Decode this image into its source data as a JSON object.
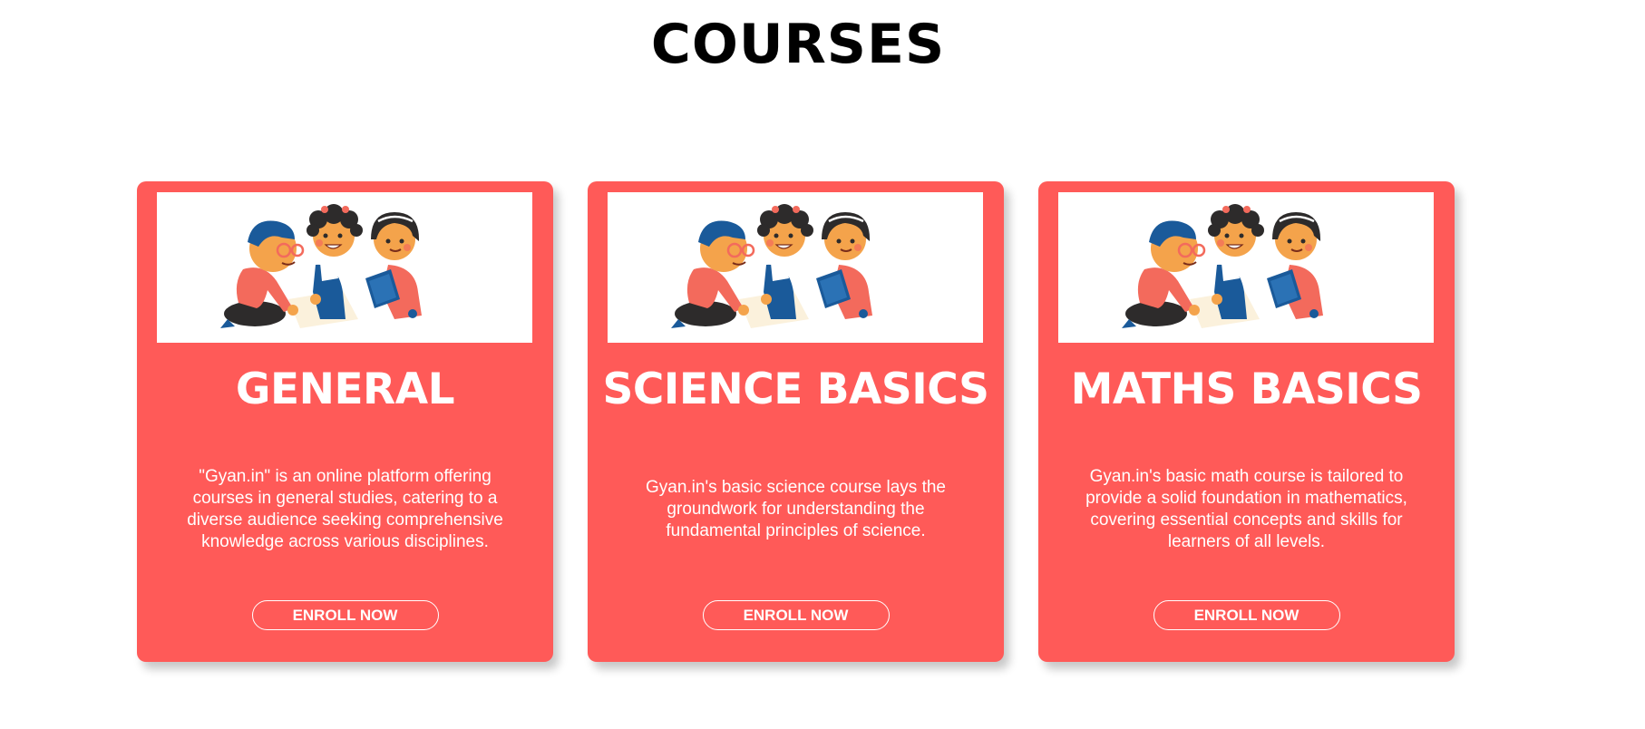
{
  "page": {
    "title": "COURSES"
  },
  "courses": [
    {
      "title": "GENERAL",
      "image_icon": "kids-studying-illustration",
      "description": "\"Gyan.in\" is an online platform offering courses in general studies, catering to a diverse audience seeking comprehensive knowledge across various disciplines.",
      "button_label": "ENROLL NOW"
    },
    {
      "title": "SCIENCE BASICS",
      "image_icon": "kids-studying-illustration",
      "description": "Gyan.in's basic science course lays the groundwork for understanding the fundamental principles of science.",
      "button_label": "ENROLL NOW"
    },
    {
      "title": "MATHS BASICS",
      "image_icon": "kids-studying-illustration",
      "description": "Gyan.in's basic math course is tailored to provide a solid foundation in mathematics, covering essential concepts and skills for learners of all levels.",
      "button_label": "ENROLL NOW"
    }
  ],
  "colors": {
    "card_bg": "#ff5a58",
    "text_on_card": "#ffffff",
    "title": "#000000"
  }
}
